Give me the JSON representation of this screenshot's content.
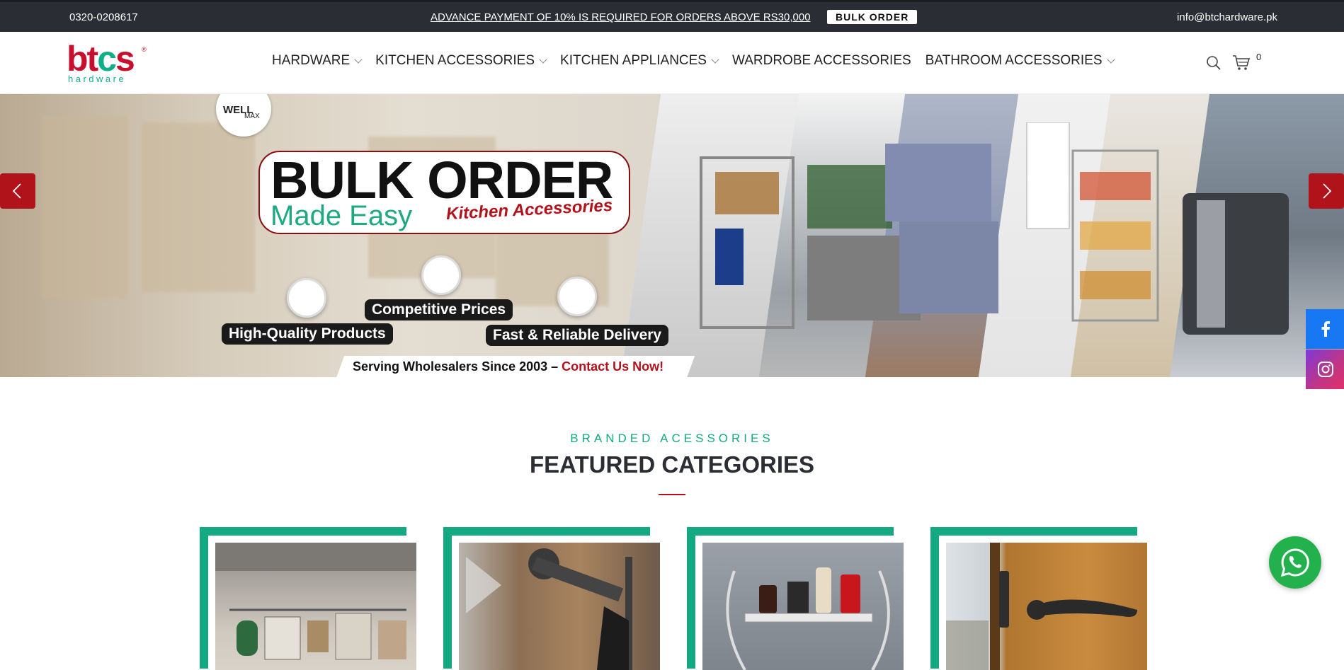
{
  "topbar": {
    "phone": "0320-0208617",
    "notice": "ADVANCE PAYMENT OF 10% IS REQUIRED FOR ORDERS ABOVE RS30,000",
    "bulk_order_label": "BULK ORDER",
    "email": "info@btchardware.pk"
  },
  "header": {
    "logo_text": "btcs",
    "logo_sub": "hardware",
    "logo_reg": "®",
    "nav": [
      {
        "label": "HARDWARE",
        "has_dropdown": true
      },
      {
        "label": "KITCHEN ACCESSORIES",
        "has_dropdown": true
      },
      {
        "label": "KITCHEN APPLIANCES",
        "has_dropdown": true
      },
      {
        "label": "WARDROBE ACCESSORIES",
        "has_dropdown": false
      },
      {
        "label": "BATHROOM ACCESSORIES",
        "has_dropdown": true
      }
    ],
    "cart_count": "0"
  },
  "hero": {
    "brand_badge": "WELL",
    "brand_badge_sub": "MAX",
    "title": "BULK ORDER",
    "subtitle": "Made Easy",
    "sub_brand": "Kitchen Accessories",
    "features": [
      "High-Quality Products",
      "Competitive Prices",
      "Fast & Reliable Delivery"
    ],
    "tagline": "Serving Wholesalers Since 2003 –",
    "tagline_cta": "Contact Us Now!"
  },
  "featured": {
    "eyebrow": "BRANDED ACESSORIES",
    "title": "FEATURED CATEGORIES"
  },
  "colors": {
    "accent_green": "#14a983",
    "brand_red": "#b3121b",
    "topbar_bg": "#2a2d34",
    "whatsapp": "#22b14c",
    "facebook": "#1877f2"
  },
  "icons": [
    "search-icon",
    "cart-icon",
    "chevron-left-icon",
    "chevron-right-icon",
    "facebook-icon",
    "instagram-icon",
    "whatsapp-icon"
  ]
}
